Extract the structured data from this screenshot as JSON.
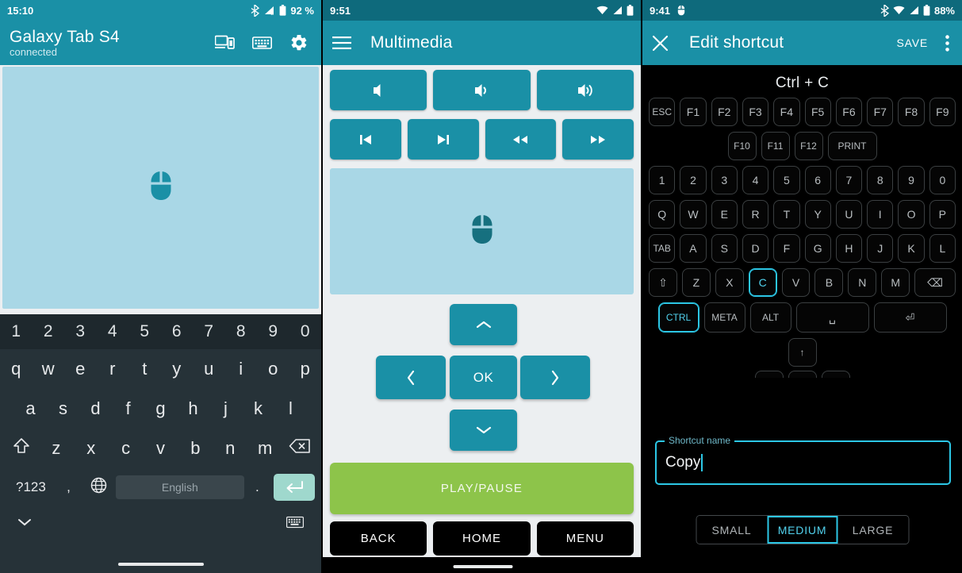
{
  "panel_left": {
    "status": {
      "time": "15:10",
      "battery": "92 %",
      "icons": [
        "bluetooth-icon",
        "signal-off-icon",
        "battery-icon"
      ]
    },
    "appbar": {
      "title": "Galaxy Tab S4",
      "subtitle": "connected",
      "actions": [
        "devices-icon",
        "keyboard-icon",
        "settings-gear-icon"
      ]
    },
    "touchpad": {
      "icon": "mouse-icon"
    },
    "keyboard": {
      "numbers": [
        "1",
        "2",
        "3",
        "4",
        "5",
        "6",
        "7",
        "8",
        "9",
        "0"
      ],
      "row_q": [
        "q",
        "w",
        "e",
        "r",
        "t",
        "y",
        "u",
        "i",
        "o",
        "p"
      ],
      "row_a": [
        "a",
        "s",
        "d",
        "f",
        "g",
        "h",
        "j",
        "k",
        "l"
      ],
      "row_z": [
        "z",
        "x",
        "c",
        "v",
        "b",
        "n",
        "m"
      ],
      "shift": "shift-icon",
      "backspace": "backspace-icon",
      "symbols": "?123",
      "comma": ",",
      "globe": "globe-icon",
      "spacebar": "English",
      "period": ".",
      "enter": "enter-icon",
      "hide_keyboard": "chevron-down-icon",
      "keyboard_switch": "keyboard-icon"
    }
  },
  "panel_middle": {
    "status": {
      "time": "9:51",
      "icons": [
        "wifi-icon",
        "signal-icon",
        "battery-icon"
      ]
    },
    "appbar": {
      "menu": "hamburger-menu-icon",
      "title": "Multimedia"
    },
    "volume": [
      {
        "name": "volume-down-button",
        "icon": "volume-low-icon"
      },
      {
        "name": "volume-mute-button",
        "icon": "volume-medium-icon"
      },
      {
        "name": "volume-up-button",
        "icon": "volume-high-icon"
      }
    ],
    "media": [
      {
        "name": "previous-track-button",
        "icon": "skip-previous-icon"
      },
      {
        "name": "next-track-button",
        "icon": "skip-next-icon"
      },
      {
        "name": "rewind-button",
        "icon": "rewind-icon"
      },
      {
        "name": "fast-forward-button",
        "icon": "fast-forward-icon"
      }
    ],
    "touchpad": {
      "icon": "mouse-icon"
    },
    "dpad": {
      "up": "chevron-up-icon",
      "left": "chevron-left-icon",
      "ok": "OK",
      "right": "chevron-right-icon",
      "down": "chevron-down-icon"
    },
    "play_pause": "PLAY/PAUSE",
    "nav": [
      "BACK",
      "HOME",
      "MENU"
    ]
  },
  "panel_right": {
    "status": {
      "time": "9:41",
      "battery": "88%",
      "icons": [
        "mouse-icon",
        "bluetooth-icon",
        "wifi-icon",
        "signal-icon",
        "battery-icon"
      ]
    },
    "appbar": {
      "close": "close-icon",
      "title": "Edit shortcut",
      "save": "SAVE",
      "overflow": "more-vert-icon"
    },
    "combo": "Ctrl + C",
    "rows": {
      "fn1": [
        "ESC",
        "F1",
        "F2",
        "F3",
        "F4",
        "F5",
        "F6",
        "F7",
        "F8",
        "F9"
      ],
      "fn2": [
        "F10",
        "F11",
        "F12",
        "PRINT"
      ],
      "numbers": [
        "1",
        "2",
        "3",
        "4",
        "5",
        "6",
        "7",
        "8",
        "9",
        "0"
      ],
      "qwerty": [
        "Q",
        "W",
        "E",
        "R",
        "T",
        "Y",
        "U",
        "I",
        "O",
        "P"
      ],
      "asdf": [
        "TAB",
        "A",
        "S",
        "D",
        "F",
        "G",
        "H",
        "J",
        "K",
        "L"
      ],
      "zxcv": [
        "⇧",
        "Z",
        "X",
        "C",
        "V",
        "B",
        "N",
        "M",
        "⌫"
      ],
      "mods": [
        "CTRL",
        "META",
        "ALT",
        "␣",
        "⏎"
      ],
      "arrow_up": "↑"
    },
    "selected_keys": [
      "C",
      "CTRL"
    ],
    "field": {
      "label": "Shortcut name",
      "value": "Copy"
    },
    "sizes": [
      "SMALL",
      "MEDIUM",
      "LARGE"
    ],
    "selected_size": "MEDIUM",
    "colors": {
      "accent": "#2cc7e6",
      "teal": "#1a90a6",
      "green": "#8dc44a",
      "touchpad": "#a9d7e6"
    }
  }
}
